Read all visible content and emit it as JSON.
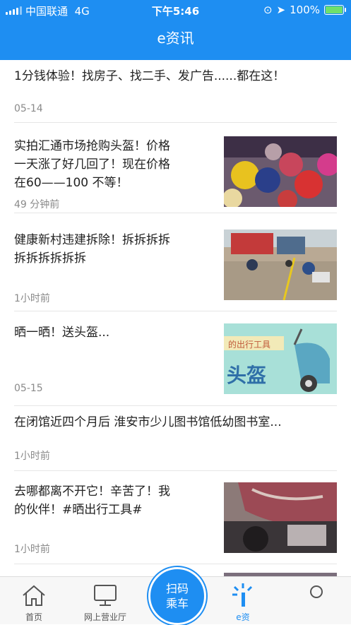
{
  "status": {
    "carrier": "中国联通",
    "network": "4G",
    "time": "下午5:46",
    "battery": "100%"
  },
  "header": {
    "title": "e资讯"
  },
  "news": [
    {
      "title_lines": [
        "1分钱体验！找房子、找二手、发广告......都在这！"
      ],
      "date": "05-14"
    },
    {
      "title_lines": [
        "实拍汇通市场抢购头盔！价格",
        "一天涨了好几回了！现在价格",
        "在60——100 不等！"
      ],
      "date": "49 分钟前",
      "thumb": "helmets-photo"
    },
    {
      "title_lines": [
        "健康新村违建拆除！拆拆拆拆",
        "拆拆拆拆拆拆"
      ],
      "date": "1小时前",
      "thumb": "street-demolition-photo"
    },
    {
      "title_lines": [
        "晒一晒！送头盔..."
      ],
      "date": "05-15",
      "thumb": "scooter-banner",
      "thumb_text_1": "的出行工具",
      "thumb_text_2": "头盔"
    },
    {
      "title_lines": [
        "在闭馆近四个月后 淮安市少儿图书馆低幼图书室..."
      ],
      "date": "1小时前"
    },
    {
      "title_lines": [
        "去哪都离不开它！辛苦了！我",
        "的伙伴！#晒出行工具#"
      ],
      "date": "1小时前",
      "thumb": "scooter-photo"
    }
  ],
  "tabbar": {
    "home": "首页",
    "hall": "网上营业厅",
    "scan_line1": "扫码",
    "scan_line2": "乘车",
    "news": "e资",
    "profile": ""
  },
  "colors": {
    "primary": "#1e8ef2"
  }
}
